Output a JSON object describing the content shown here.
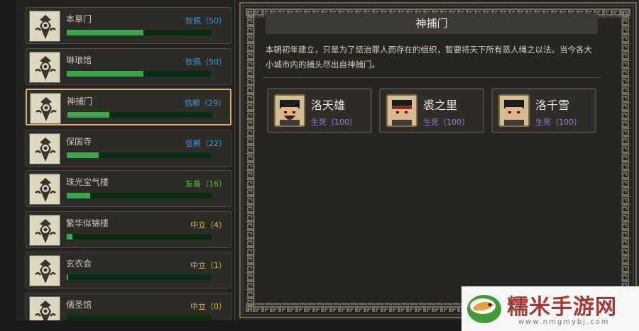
{
  "factions": [
    {
      "name": "本草门",
      "status": "钦佩（50）",
      "status_color": "#3b9be0",
      "progress": 0.53
    },
    {
      "name": "琳琅馆",
      "status": "钦佩（50）",
      "status_color": "#3b9be0",
      "progress": 0.53
    },
    {
      "name": "神捕门",
      "status": "信赖（29）",
      "status_color": "#3b9be0",
      "progress": 0.29,
      "selected": true
    },
    {
      "name": "保国寺",
      "status": "信赖（22）",
      "status_color": "#3b9be0",
      "progress": 0.22
    },
    {
      "name": "珠光宝气楼",
      "status": "友善（16）",
      "status_color": "#5fbd4a",
      "progress": 0.16
    },
    {
      "name": "繁华似锦楼",
      "status": "中立（4）",
      "status_color": "#d9b94f",
      "progress": 0.04
    },
    {
      "name": "玄衣会",
      "status": "中立（1）",
      "status_color": "#d9b94f",
      "progress": 0.01
    },
    {
      "name": "儒圣馆",
      "status": "中立（0）",
      "status_color": "#d9b94f",
      "progress": 0.0
    }
  ],
  "detail": {
    "title": "神捕门",
    "description": "本朝初年建立，只是为了惩治罪人而存在的组织，暂要将天下所有恶人绳之以法。当今各大小城市内的捕头尽出自神捕门。",
    "members": [
      {
        "name": "洛天雄",
        "status": "生死（100）",
        "icon": "bearded-man-portrait"
      },
      {
        "name": "裘之里",
        "status": "生死（100）",
        "icon": "capped-man-portrait"
      },
      {
        "name": "洛千雪",
        "status": "生死（100）",
        "icon": "young-man-portrait"
      }
    ]
  },
  "watermark": {
    "text": "糯米手游网",
    "url": "www.nmgmybj.com"
  },
  "colors": {
    "accent_gold": "#d9b56a",
    "bar_green": "#3fa34d",
    "member_status": "#9f79d8"
  }
}
